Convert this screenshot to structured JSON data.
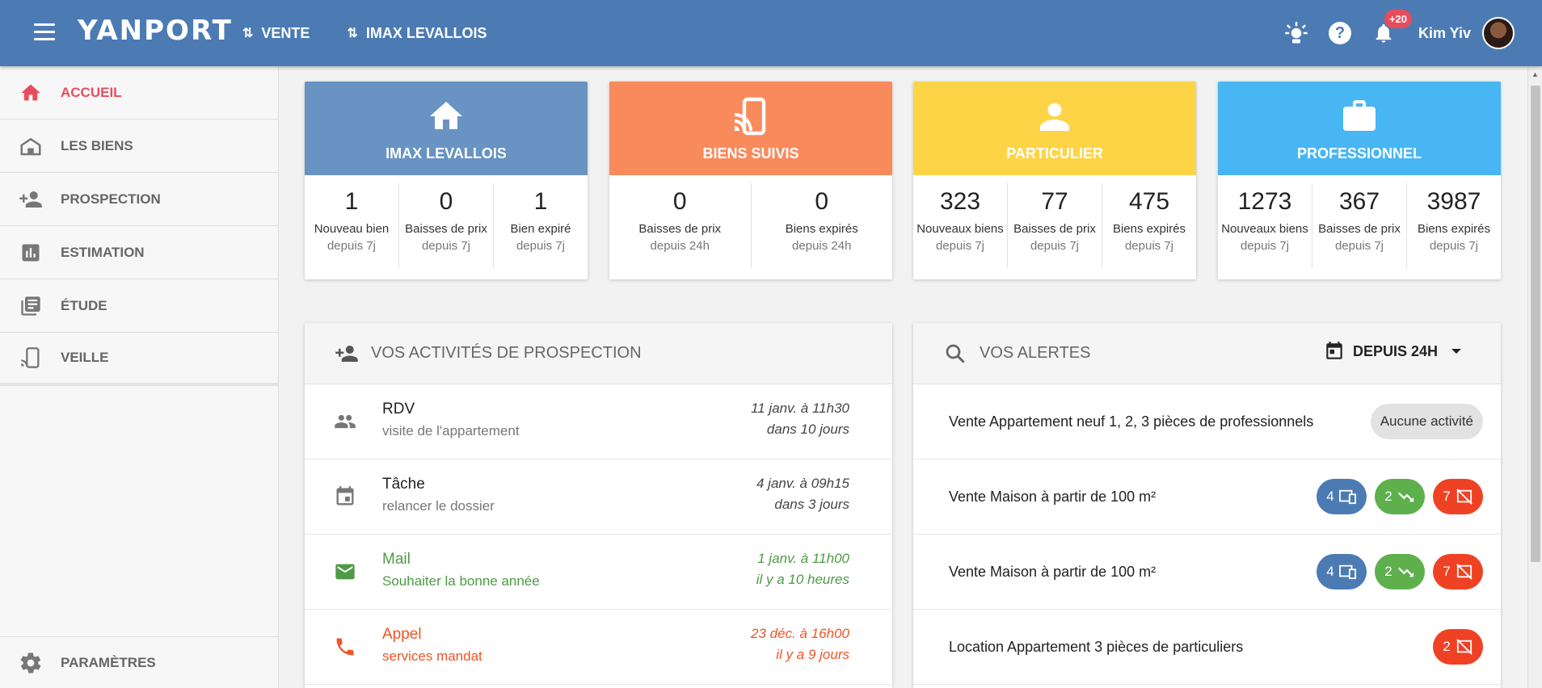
{
  "header": {
    "brand": "YANPORT",
    "nav": [
      {
        "label": "VENTE"
      },
      {
        "label": "IMAX LEVALLOIS"
      }
    ],
    "notifications_badge": "+20",
    "user_name": "Kim Yiv"
  },
  "sidebar": {
    "items": [
      {
        "label": "ACCUEIL",
        "icon": "home-icon",
        "active": true
      },
      {
        "label": "LES BIENS",
        "icon": "property-icon"
      },
      {
        "label": "PROSPECTION",
        "icon": "person-add-icon"
      },
      {
        "label": "ESTIMATION",
        "icon": "bar-chart-icon"
      },
      {
        "label": "ÉTUDE",
        "icon": "library-icon"
      },
      {
        "label": "VEILLE",
        "icon": "cast-icon"
      }
    ],
    "footer": {
      "label": "PARAMÈTRES",
      "icon": "gear-icon"
    }
  },
  "cards": [
    {
      "title": "IMAX LEVALLOIS",
      "color": "#6893c2",
      "icon": "home-icon",
      "stats": [
        {
          "value": "1",
          "label": "Nouveau bien",
          "sub": "depuis 7j"
        },
        {
          "value": "0",
          "label": "Baisses de prix",
          "sub": "depuis 7j"
        },
        {
          "value": "1",
          "label": "Bien expiré",
          "sub": "depuis 7j"
        }
      ]
    },
    {
      "title": "BIENS SUIVIS",
      "color": "#f98a5c",
      "icon": "cast-icon",
      "stats": [
        {
          "value": "0",
          "label": "Baisses de prix",
          "sub": "depuis 24h"
        },
        {
          "value": "0",
          "label": "Biens expirés",
          "sub": "depuis 24h"
        }
      ]
    },
    {
      "title": "PARTICULIER",
      "color": "#fdd446",
      "icon": "person-icon",
      "stats": [
        {
          "value": "323",
          "label": "Nouveaux biens",
          "sub": "depuis 7j"
        },
        {
          "value": "77",
          "label": "Baisses de prix",
          "sub": "depuis 7j"
        },
        {
          "value": "475",
          "label": "Biens expirés",
          "sub": "depuis 7j"
        }
      ]
    },
    {
      "title": "PROFESSIONNEL",
      "color": "#47b6f3",
      "icon": "briefcase-icon",
      "stats": [
        {
          "value": "1273",
          "label": "Nouveaux biens",
          "sub": "depuis 7j"
        },
        {
          "value": "367",
          "label": "Baisses de prix",
          "sub": "depuis 7j"
        },
        {
          "value": "3987",
          "label": "Biens expirés",
          "sub": "depuis 7j"
        }
      ]
    }
  ],
  "activities": {
    "title": "VOS ACTIVITÉS DE PROSPECTION",
    "items": [
      {
        "type": "rdv",
        "icon": "people-icon",
        "title": "RDV",
        "desc": "visite de l'appartement",
        "date": "11 janv. à 11h30",
        "relative": "dans 10 jours"
      },
      {
        "type": "task",
        "icon": "calendar-icon",
        "title": "Tâche",
        "desc": "relancer le dossier",
        "date": "4 janv. à 09h15",
        "relative": "dans 3 jours"
      },
      {
        "type": "mail",
        "icon": "mail-icon",
        "title": "Mail",
        "desc": "Souhaiter la bonne année",
        "date": "1 janv. à 11h00",
        "relative": "il y a 10 heures"
      },
      {
        "type": "call",
        "icon": "phone-icon",
        "title": "Appel",
        "desc": "services mandat",
        "date": "23 déc. à 16h00",
        "relative": "il y a 9 jours"
      }
    ]
  },
  "alerts": {
    "title": "VOS ALERTES",
    "period": "DEPUIS 24H",
    "items": [
      {
        "label": "Vente Appartement neuf 1, 2, 3 pièces de professionnels",
        "empty": "Aucune activité"
      },
      {
        "label": "Vente Maison à partir de 100 m²",
        "new": "4",
        "drops": "2",
        "expired": "7"
      },
      {
        "label": "Vente Maison à partir de 100 m²",
        "new": "4",
        "drops": "2",
        "expired": "7"
      },
      {
        "label": "Location Appartement 3 pièces de particuliers",
        "expired": "2"
      }
    ]
  },
  "colors": {
    "header": "#4c7bb4",
    "active": "#e74c5c",
    "mail": "#4e9a45",
    "call": "#ef5424"
  }
}
